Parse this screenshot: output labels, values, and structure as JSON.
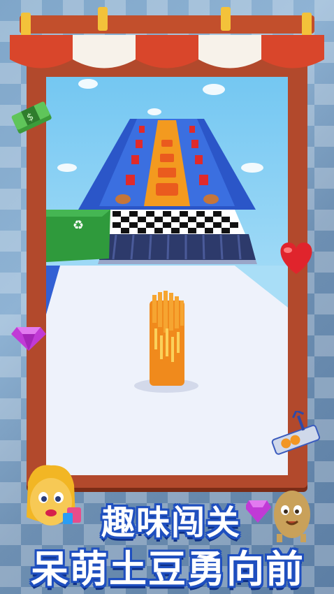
{
  "promo": {
    "title_line1": "趣味闯关",
    "title_line2": "呆萌土豆勇向前"
  },
  "icons": {
    "cash": "cash-stack-icon",
    "gem": "purple-gem-icon",
    "heart": "red-heart-icon",
    "claw": "claw-machine-icon",
    "recycle": "recycle-bin-icon"
  },
  "colors": {
    "title_fill": "#ffffff",
    "title_outline": "#1f4fbf",
    "frame": "#b2492c",
    "awning_red": "#d9462b",
    "awning_white": "#f7f2ea",
    "fries": "#f08a1c"
  }
}
